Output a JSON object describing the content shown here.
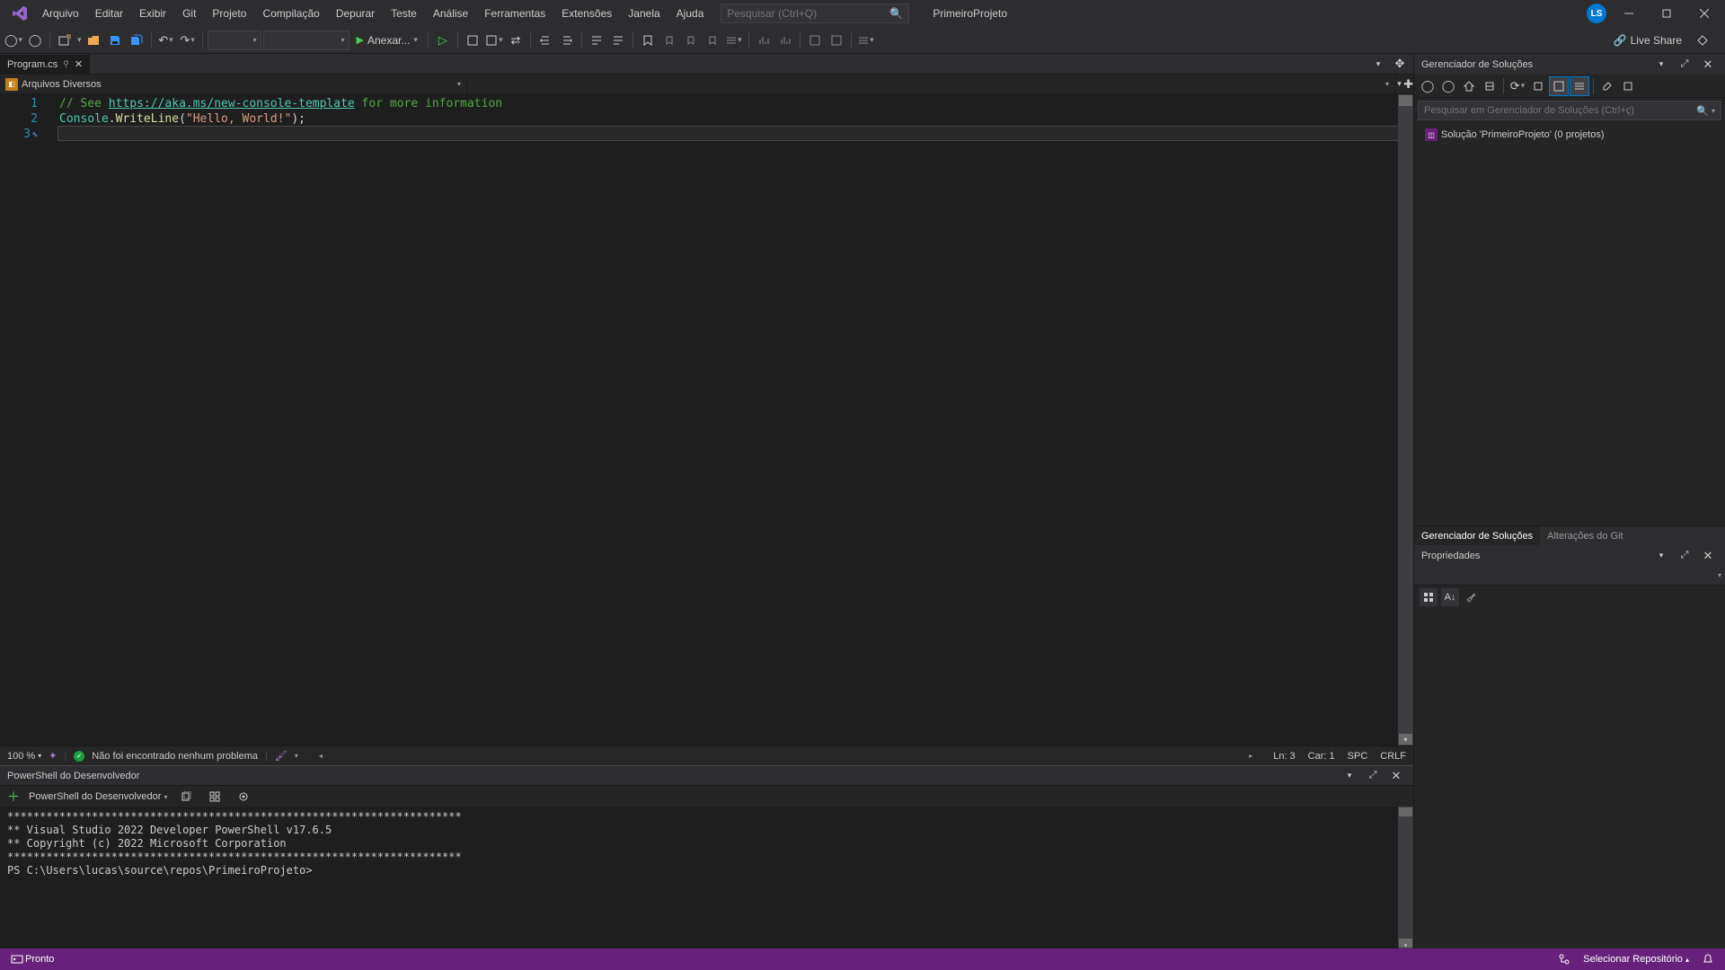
{
  "menubar": {
    "items": [
      "Arquivo",
      "Editar",
      "Exibir",
      "Git",
      "Projeto",
      "Compilação",
      "Depurar",
      "Teste",
      "Análise",
      "Ferramentas",
      "Extensões",
      "Janela",
      "Ajuda"
    ],
    "search_placeholder": "Pesquisar (Ctrl+Q)",
    "project_name": "PrimeiroProjeto",
    "user_initials": "LS"
  },
  "toolbar": {
    "attach_label": "Anexar...",
    "live_share": "Live Share"
  },
  "tabs": {
    "active": "Program.cs"
  },
  "navbar": {
    "scope": "Arquivos Diversos"
  },
  "code": {
    "line1_pre": "// See ",
    "line1_link": "https://aka.ms/new-console-template",
    "line1_post": " for more information",
    "line2_class": "Console",
    "line2_dot": ".",
    "line2_method": "WriteLine",
    "line2_open": "(",
    "line2_str": "\"Hello, World!\"",
    "line2_close": ");",
    "ln1": "1",
    "ln2": "2",
    "ln3": "3"
  },
  "editor_status": {
    "zoom": "100 %",
    "problems": "Não foi encontrado nenhum problema",
    "ln": "Ln: 3",
    "car": "Car: 1",
    "spc": "SPC",
    "crlf": "CRLF"
  },
  "terminal": {
    "title": "PowerShell do Desenvolvedor",
    "shell_name": "PowerShell do Desenvolvedor",
    "line1": "**********************************************************************",
    "line2": "** Visual Studio 2022 Developer PowerShell v17.6.5",
    "line3": "** Copyright (c) 2022 Microsoft Corporation",
    "line4": "**********************************************************************",
    "prompt": "PS C:\\Users\\lucas\\source\\repos\\PrimeiroProjeto>"
  },
  "solution_explorer": {
    "title": "Gerenciador de Soluções",
    "search_placeholder": "Pesquisar em Gerenciador de Soluções (Ctrl+ç)",
    "root": "Solução 'PrimeiroProjeto' (0 projetos)",
    "tab1": "Gerenciador de Soluções",
    "tab2": "Alterações do Git"
  },
  "properties": {
    "title": "Propriedades"
  },
  "statusbar": {
    "ready": "Pronto",
    "repo": "Selecionar Repositório"
  }
}
